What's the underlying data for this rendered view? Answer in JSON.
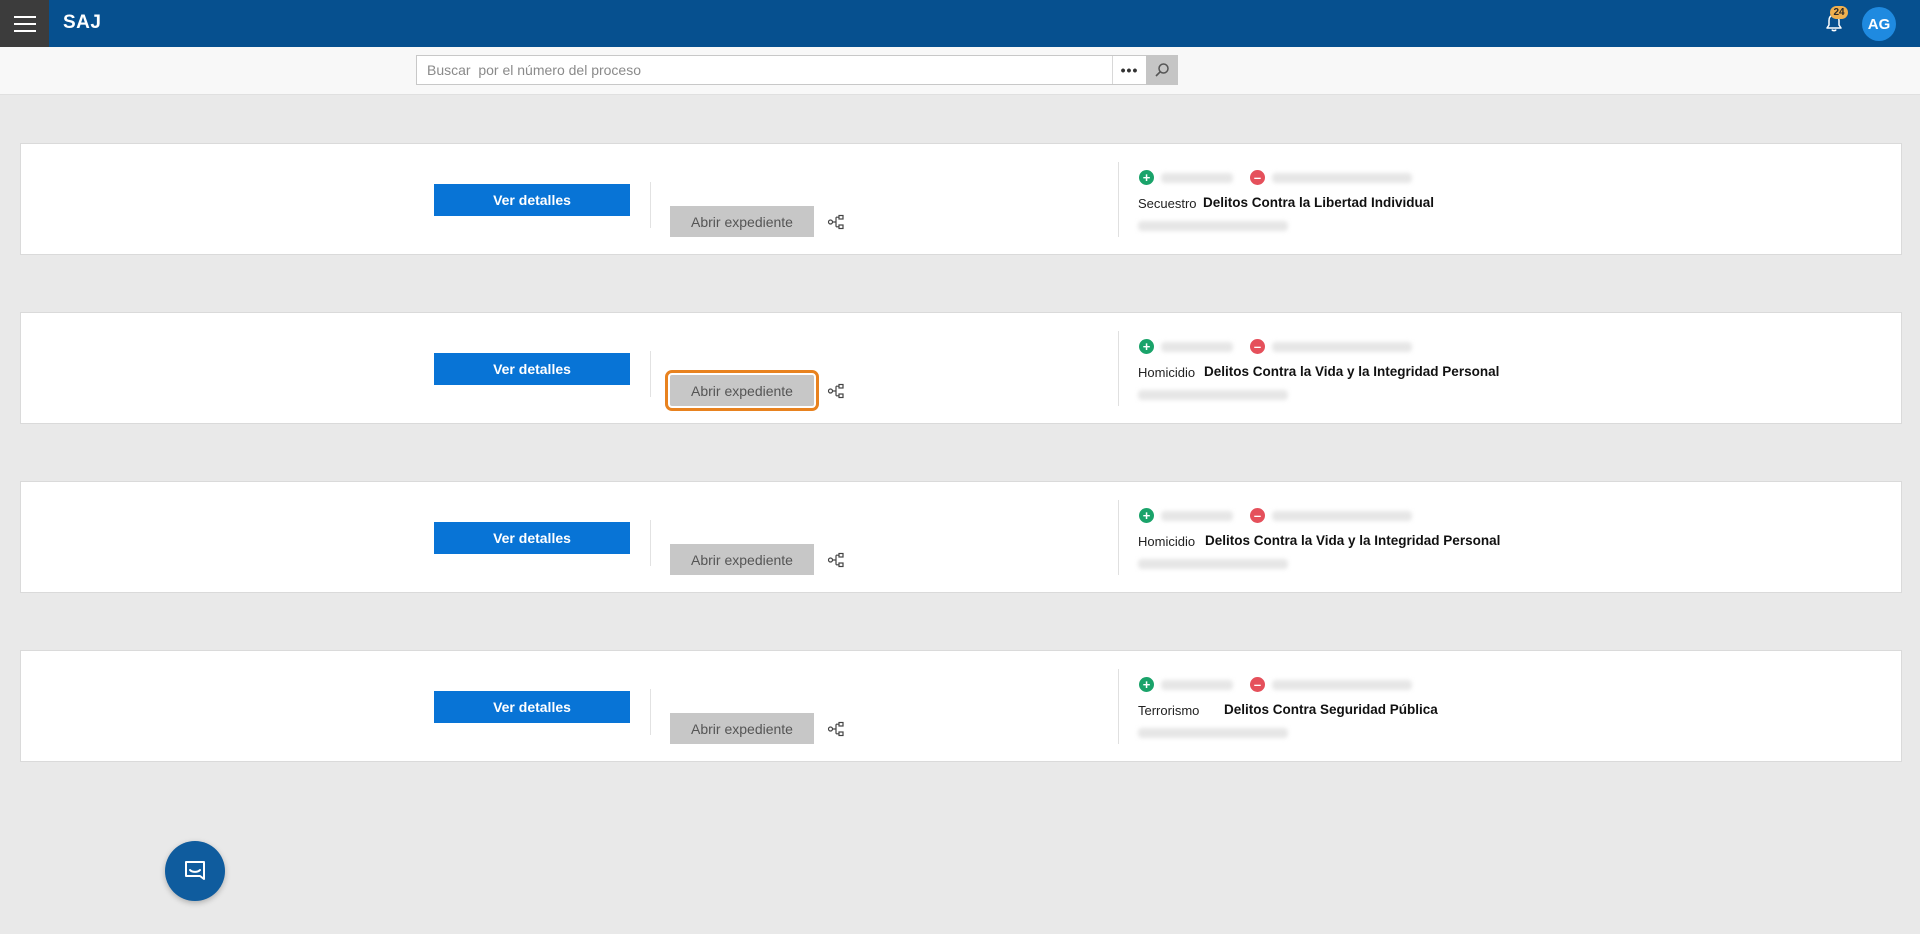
{
  "header": {
    "app_title": "SAJ",
    "notification_count": "24",
    "user_initials": "AG"
  },
  "search": {
    "placeholder": "Buscar  por el número del proceso",
    "value": "",
    "more_label": "•••"
  },
  "cases": [
    {
      "details_label": "Ver detalles",
      "open_label": "Abrir expediente",
      "crime_type": "Secuestro",
      "crime_category": "Delitos Contra la Libertad Individual"
    },
    {
      "details_label": "Ver detalles",
      "open_label": "Abrir expediente",
      "crime_type": "Homicidio",
      "crime_category": "Delitos Contra la Vida y la Integridad Personal"
    },
    {
      "details_label": "Ver detalles",
      "open_label": "Abrir expediente",
      "crime_type": "Homicidio",
      "crime_category": "Delitos Contra la Vida y la Integridad Personal"
    },
    {
      "details_label": "Ver detalles",
      "open_label": "Abrir expediente",
      "crime_type": "Terrorismo",
      "crime_category": "Delitos Contra Seguridad Pública"
    }
  ],
  "colors": {
    "header_bg": "#06508f",
    "primary_button": "#0874d6",
    "secondary_button": "#c7c7c7",
    "focus_outline": "#e8821f",
    "plus_green": "#1aa36a",
    "minus_red": "#e5505b"
  },
  "icons": {
    "menu": "hamburger-menu-icon",
    "notifications": "bell-icon",
    "search": "search-icon",
    "tree": "process-tree-icon",
    "chat": "chat-icon"
  }
}
